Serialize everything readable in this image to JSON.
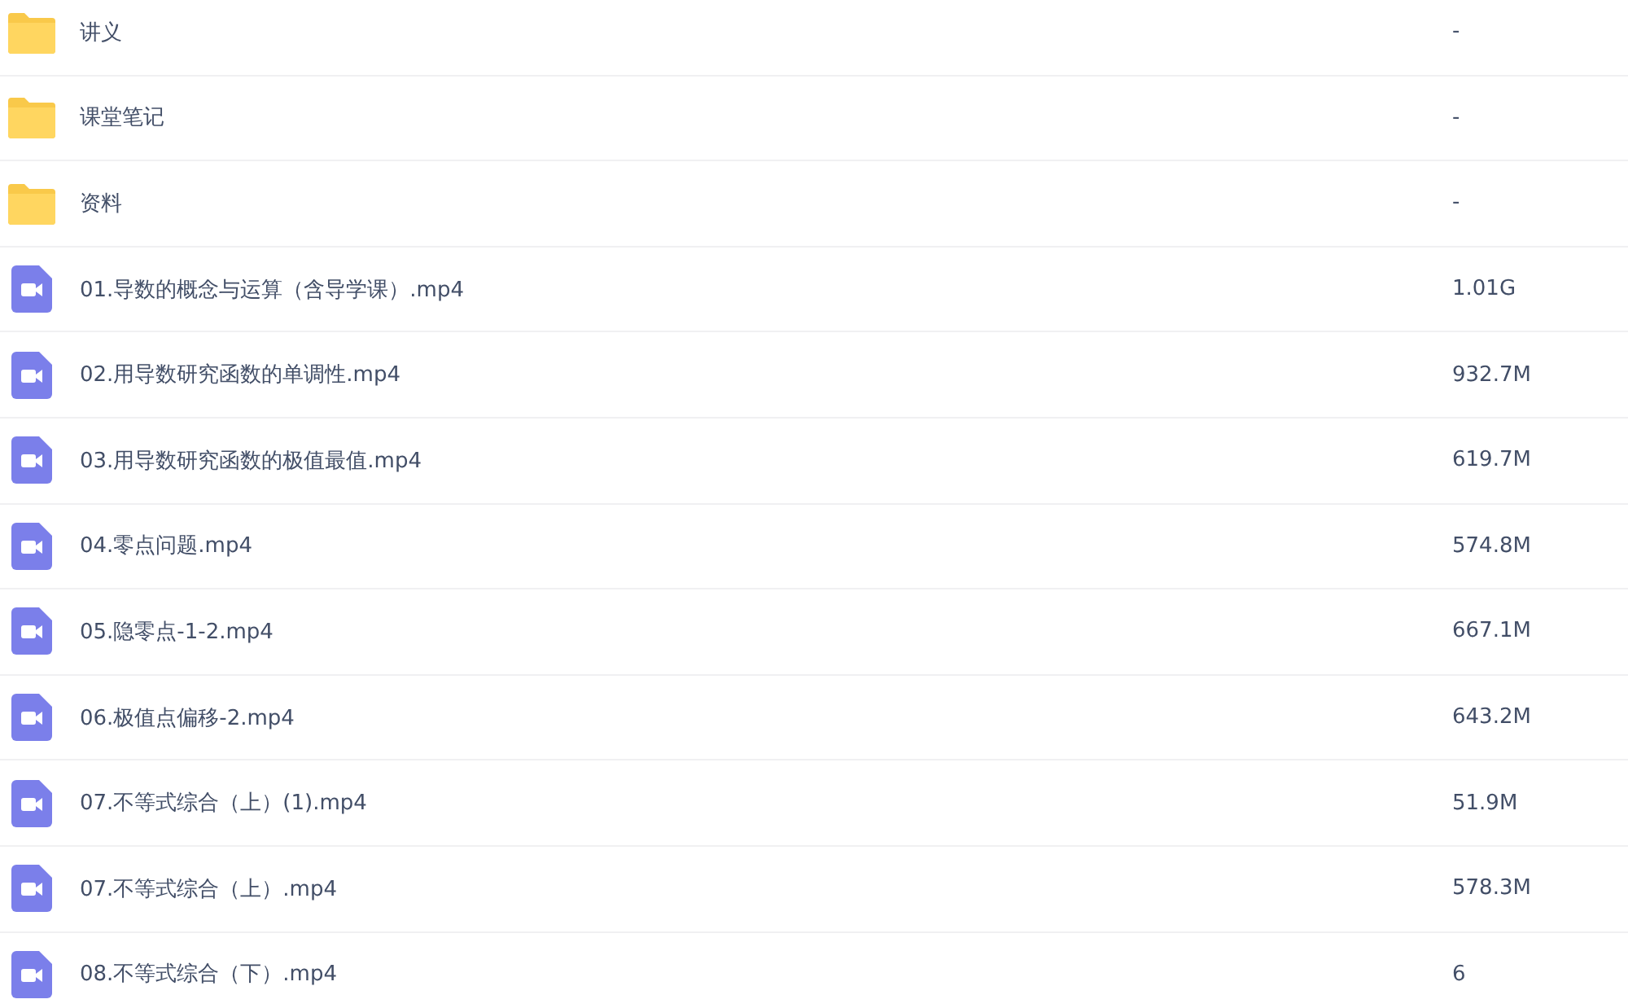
{
  "files": [
    {
      "kind": "folder",
      "name": "讲义",
      "size": "-"
    },
    {
      "kind": "folder",
      "name": "课堂笔记",
      "size": "-"
    },
    {
      "kind": "folder",
      "name": "资料",
      "size": "-"
    },
    {
      "kind": "video",
      "name": "01.导数的概念与运算（含导学课）.mp4",
      "size": "1.01G"
    },
    {
      "kind": "video",
      "name": "02.用导数研究函数的单调性.mp4",
      "size": "932.7M"
    },
    {
      "kind": "video",
      "name": "03.用导数研究函数的极值最值.mp4",
      "size": "619.7M"
    },
    {
      "kind": "video",
      "name": "04.零点问题.mp4",
      "size": "574.8M"
    },
    {
      "kind": "video",
      "name": "05.隐零点-1-2.mp4",
      "size": "667.1M"
    },
    {
      "kind": "video",
      "name": "06.极值点偏移-2.mp4",
      "size": "643.2M"
    },
    {
      "kind": "video",
      "name": "07.不等式综合（上）(1).mp4",
      "size": "51.9M"
    },
    {
      "kind": "video",
      "name": "07.不等式综合（上）.mp4",
      "size": "578.3M"
    },
    {
      "kind": "video",
      "name": "08.不等式综合（下）.mp4",
      "size": "6"
    }
  ]
}
